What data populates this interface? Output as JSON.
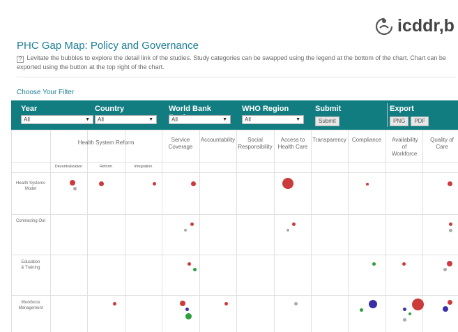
{
  "logo": {
    "text": "icddr,b"
  },
  "page": {
    "title": "PHC Gap Map: Policy and Governance",
    "help_mark": "?",
    "description": "Levitate the bubbles to explore the detail link of the studies. Study categories can be swapped using the legend at the bottom of the chart. Chart can be exported using the button at the top right of the chart.",
    "filter_title": "Choose Your Filter"
  },
  "filters": {
    "year": {
      "label": "Year",
      "value": "All"
    },
    "country": {
      "label": "Country",
      "value": "All"
    },
    "wb_region": {
      "label": "World Bank Region",
      "value": "All"
    },
    "who_region": {
      "label": "WHO Region",
      "value": "All"
    },
    "submit": {
      "label": "Submit",
      "button": "Submit"
    },
    "export": {
      "label": "Export",
      "png": "PNG",
      "pdf": "PDF"
    }
  },
  "columns": {
    "hsr": "Health System Reform",
    "service": "Service Coverage",
    "accountability": "Accountability",
    "social": "Social Responsibility",
    "access": "Access to Health Care",
    "transparency": "Transparency",
    "compliance": "Compliance",
    "workforce_avail": "Availability of Workforce",
    "quality": "Quality of Care"
  },
  "subcolumns": {
    "decentralization": "Decentralization",
    "reform": "Reform",
    "integration": "Integration"
  },
  "rows": {
    "hsm": "Health Systems Model",
    "contracting": "Contracting Out",
    "education": "Education & Training",
    "workforce": "Workforce Management"
  },
  "colors": {
    "red": "#cc3b3b",
    "gray": "#aaaaaa",
    "green": "#2f9e3f",
    "blue": "#3b2fa8",
    "teal": "#127d80",
    "title": "#1c7d96"
  }
}
